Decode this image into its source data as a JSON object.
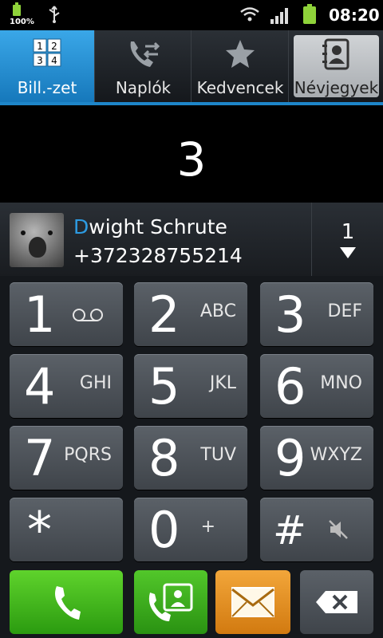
{
  "status": {
    "battery_percent": "100%",
    "time": "08:20",
    "icons": [
      "battery-icon",
      "usb-icon",
      "wifi-icon",
      "signal-icon",
      "battery-icon"
    ]
  },
  "tabs": [
    {
      "label": "Bill.-zet",
      "icon": "keypad-icon",
      "active": true
    },
    {
      "label": "Naplók",
      "icon": "call-log-icon",
      "active": false
    },
    {
      "label": "Kedvencek",
      "icon": "star-icon",
      "active": false
    },
    {
      "label": "Névjegyek",
      "icon": "contacts-icon",
      "active": false
    }
  ],
  "keypad_grid": {
    "one": "1",
    "two": "2",
    "three": "3",
    "four": "4"
  },
  "display": {
    "number": "3"
  },
  "contact": {
    "name_highlight": "D",
    "name_rest": "wight Schrute",
    "phone": "+372328755214",
    "match_count": "1"
  },
  "keys": [
    {
      "digit": "1",
      "letters": ""
    },
    {
      "digit": "2",
      "letters": "ABC"
    },
    {
      "digit": "3",
      "letters": "DEF"
    },
    {
      "digit": "4",
      "letters": "GHI"
    },
    {
      "digit": "5",
      "letters": "JKL"
    },
    {
      "digit": "6",
      "letters": "MNO"
    },
    {
      "digit": "7",
      "letters": "PQRS"
    },
    {
      "digit": "8",
      "letters": "TUV"
    },
    {
      "digit": "9",
      "letters": "WXYZ"
    },
    {
      "digit": "*",
      "letters": ""
    },
    {
      "digit": "0",
      "letters": "+"
    },
    {
      "digit": "#",
      "letters": ""
    }
  ],
  "colors": {
    "accent": "#1e86c9",
    "call_green": "#2b9b10",
    "message_orange": "#d27a10"
  }
}
